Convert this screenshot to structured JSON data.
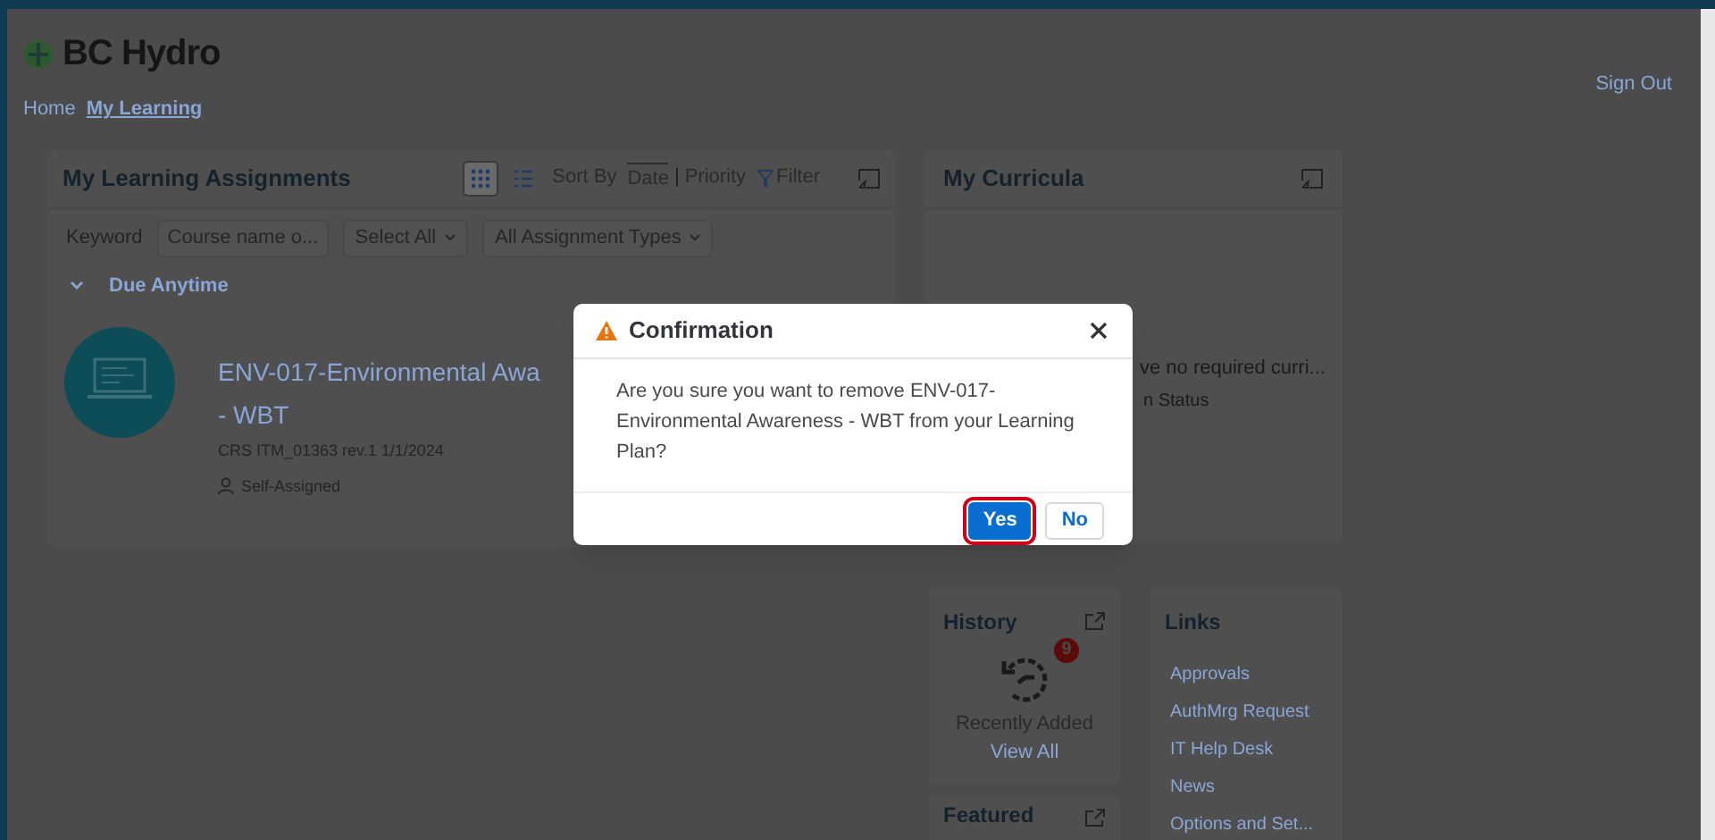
{
  "header": {
    "logo": "BC Hydro",
    "sign_out": "Sign Out"
  },
  "breadcrumbs": [
    {
      "label": "Home",
      "selected": false
    },
    {
      "label": "My Learning",
      "selected": true
    }
  ],
  "assignments": {
    "title": "My Learning Assignments",
    "view_toggle": [
      {
        "kind": "grid",
        "selected": true
      },
      {
        "kind": "list",
        "selected": false
      }
    ],
    "sort_label": "Sort By",
    "sort_separator": "|",
    "sort_options": [
      {
        "label": "Date",
        "selected": true
      },
      {
        "label": "Priority",
        "selected": false
      }
    ],
    "filter": "Filter",
    "keyword_label": "Keyword",
    "keyword": {
      "placeholder": "Course name o..."
    },
    "dropdowns": [
      "Select All",
      "All Assignment Types"
    ],
    "group": {
      "label": "Due Anytime",
      "expanded": true
    },
    "items": [
      {
        "title": "ENV-017-Environmental Awa",
        "title_line_2": "- WBT",
        "meta": "CRS ITM_01363 rev.1 1/1/2024",
        "assigned": "Self-Assigned"
      }
    ]
  },
  "curricula": {
    "title": "My Curricula",
    "message": "ve no required curri...",
    "status": "n Status"
  },
  "history": {
    "title": "History",
    "badge": "9",
    "label": "Recently Added",
    "link": "View All"
  },
  "links": {
    "title": "Links",
    "items": [
      "Approvals",
      "AuthMrg Request",
      "IT Help Desk",
      "News",
      "Options and Set..."
    ]
  },
  "featured": {
    "title": "Featured"
  },
  "dialog": {
    "title": "Confirmation",
    "message": "Are you sure you want to remove ENV-017-Environmental Awareness - WBT from your Learning Plan?",
    "buttons": [
      {
        "label": "Yes",
        "selected": true
      },
      {
        "label": "No",
        "selected": false
      }
    ]
  }
}
